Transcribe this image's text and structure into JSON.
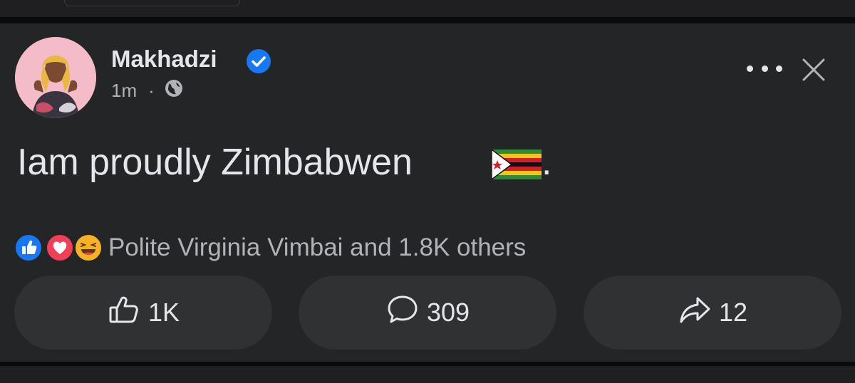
{
  "post": {
    "author": "Makhadzi",
    "time": "1m",
    "separator": "·",
    "privacy_icon": "globe-icon",
    "text": "Iam proudly Zimbabwen",
    "text_suffix": ".",
    "flag_emoji": "zimbabwe-flag"
  },
  "reactions": {
    "icons": [
      "like-reaction-icon",
      "love-reaction-icon",
      "haha-reaction-icon"
    ],
    "summary": "Polite Virginia Vimbai and 1.8K others"
  },
  "actions": {
    "like_count": "1K",
    "comment_count": "309",
    "share_count": "12"
  },
  "colors": {
    "card_bg": "#242526",
    "button_bg": "#303133",
    "verified_blue": "#1877f2",
    "like_blue": "#1877f2",
    "love_red": "#f33e58",
    "haha_yellow": "#f7b125"
  }
}
